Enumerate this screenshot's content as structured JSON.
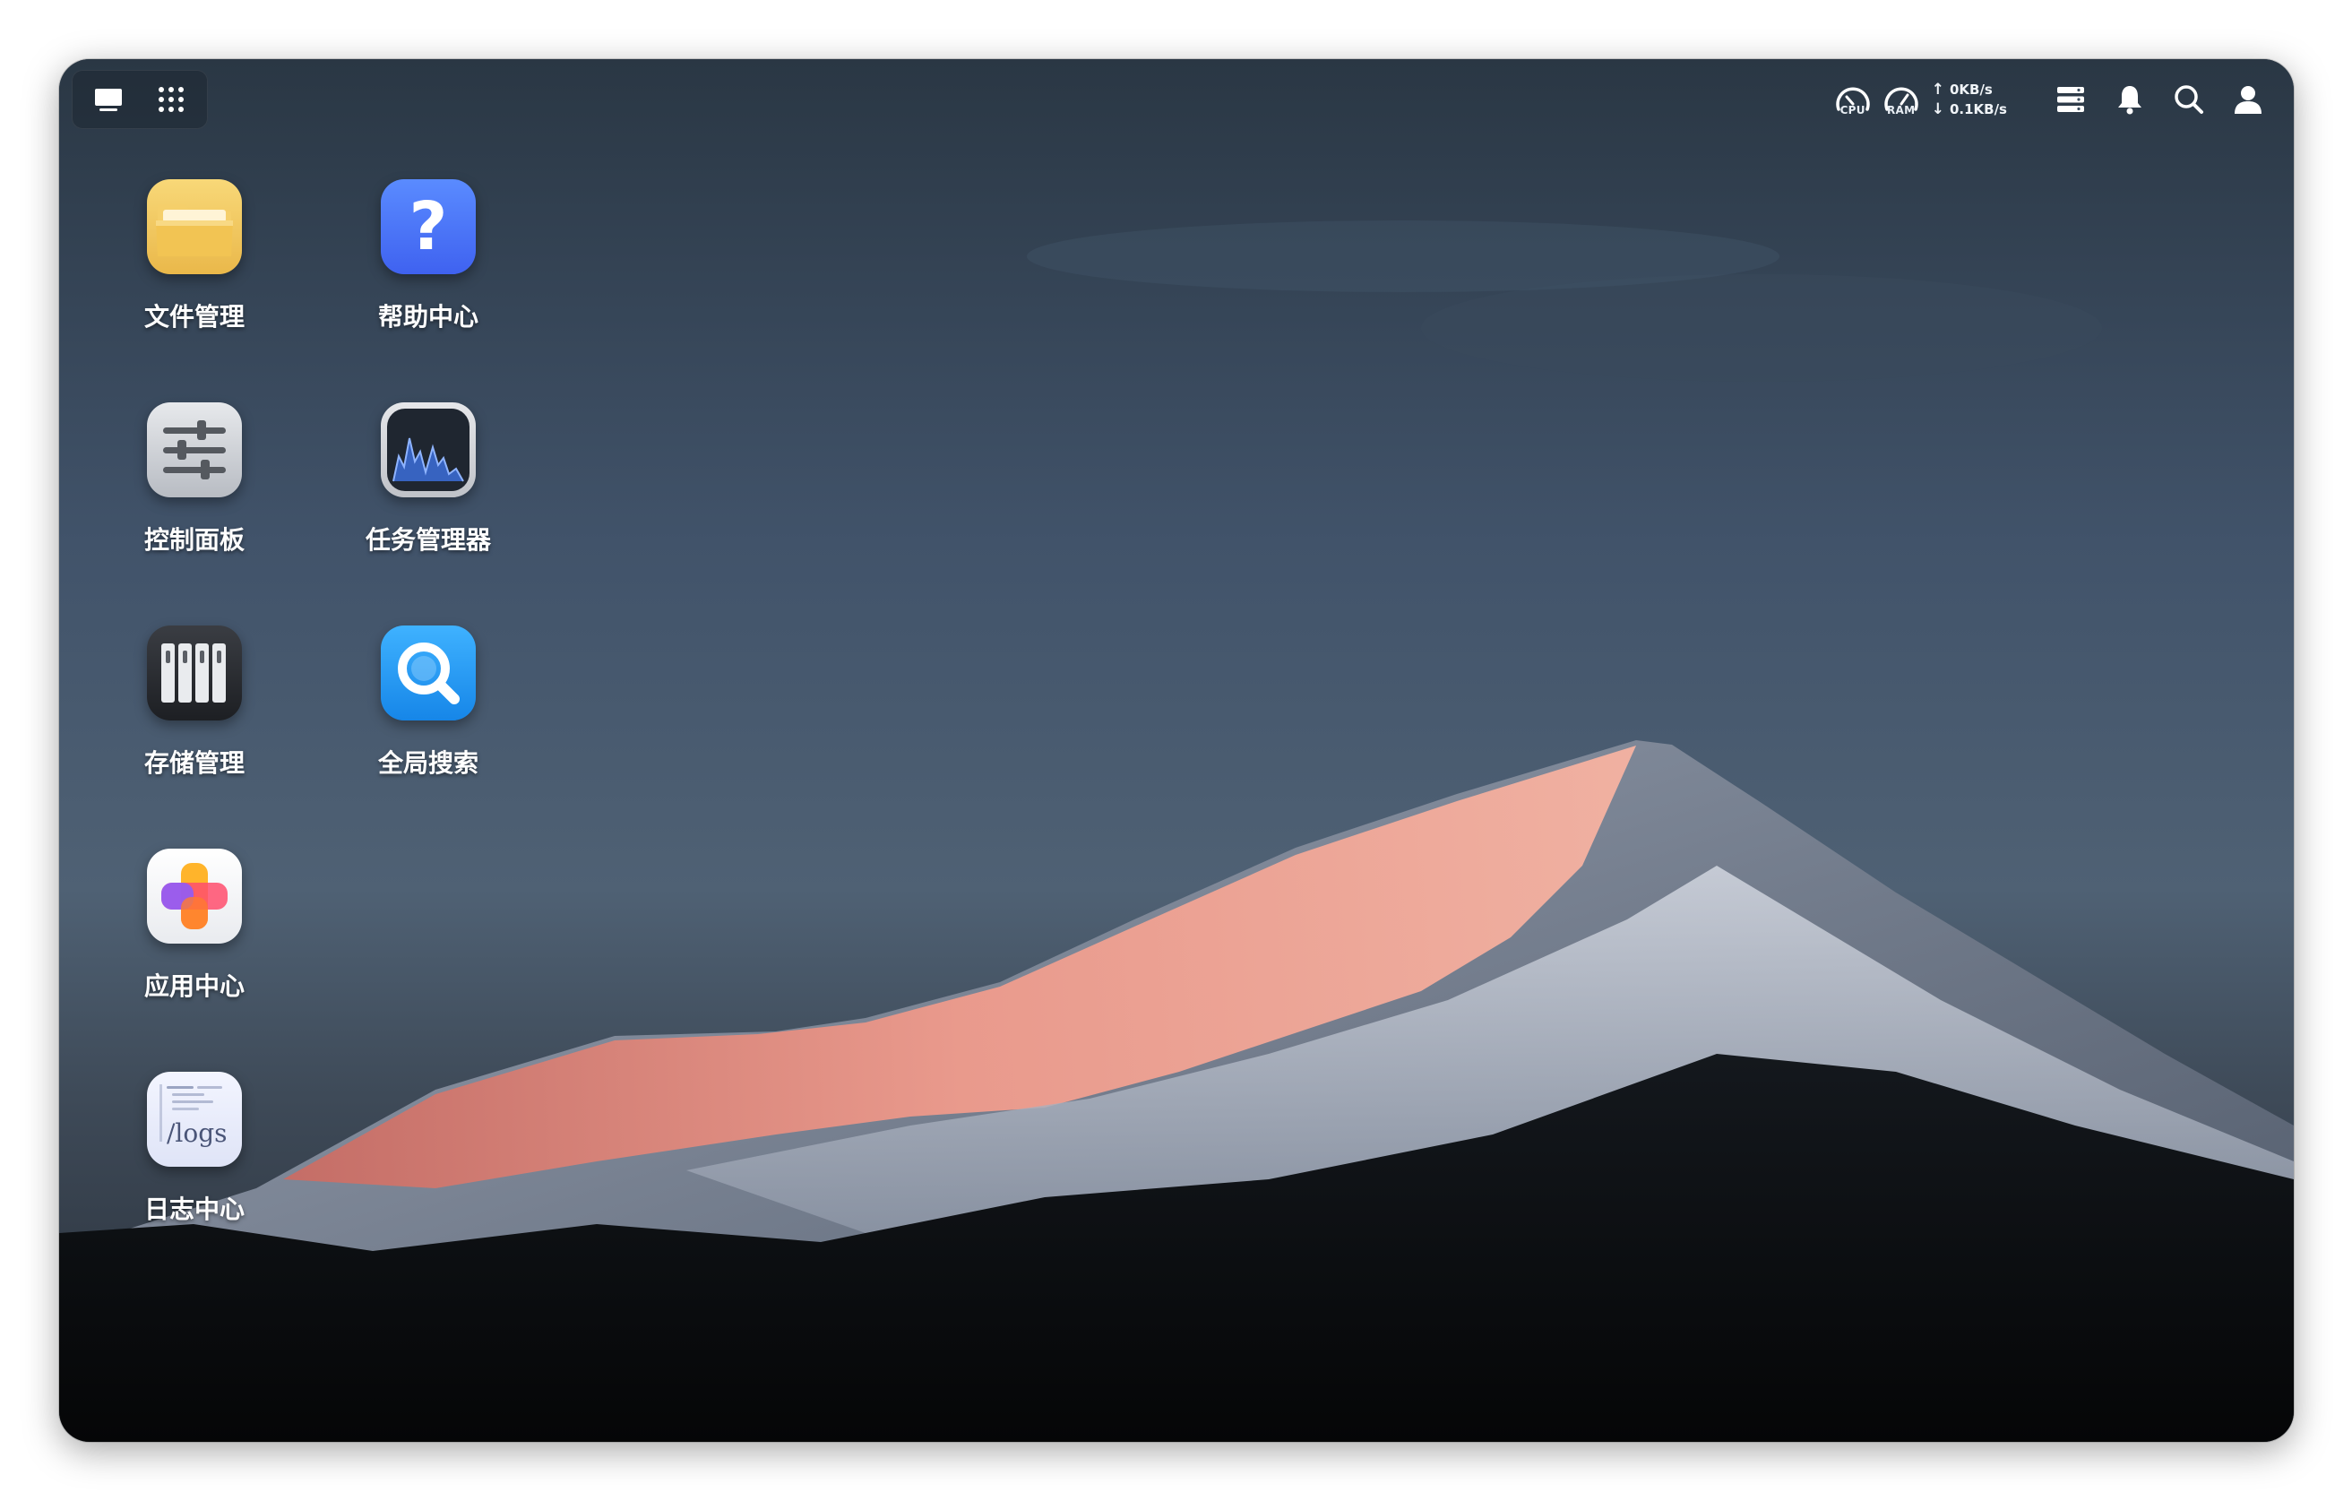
{
  "taskbar": {
    "left": {
      "desktop_icon": "desktop-icon",
      "menu_icon": "grid-menu-icon"
    },
    "monitor": {
      "cpu_label": "CPU",
      "ram_label": "RAM",
      "upload": "0KB/s",
      "download": "0.1KB/s"
    },
    "icons": [
      "storage-status-icon",
      "bell-icon",
      "search-icon",
      "user-icon"
    ]
  },
  "desktop": {
    "apps": [
      {
        "id": "file-manager",
        "label": "文件管理",
        "icon": "folder-icon"
      },
      {
        "id": "help-center",
        "label": "帮助中心",
        "icon": "question-icon"
      },
      {
        "id": "control-panel",
        "label": "控制面板",
        "icon": "sliders-icon"
      },
      {
        "id": "task-manager",
        "label": "任务管理器",
        "icon": "activity-graph-icon"
      },
      {
        "id": "storage-manager",
        "label": "存储管理",
        "icon": "drive-bays-icon"
      },
      {
        "id": "global-search",
        "label": "全局搜索",
        "icon": "magnifier-icon"
      },
      {
        "id": "app-center",
        "label": "应用中心",
        "icon": "app-center-icon"
      },
      {
        "id": "log-center",
        "label": "日志中心",
        "icon": "logs-icon",
        "icon_text": "/logs"
      }
    ]
  },
  "colors": {
    "sky_top": "#2b3845",
    "sky_mid": "#4a5c6f",
    "alpenglow": "#e88a7c",
    "snow": "#c9ced8",
    "forest": "#0b0d10"
  }
}
